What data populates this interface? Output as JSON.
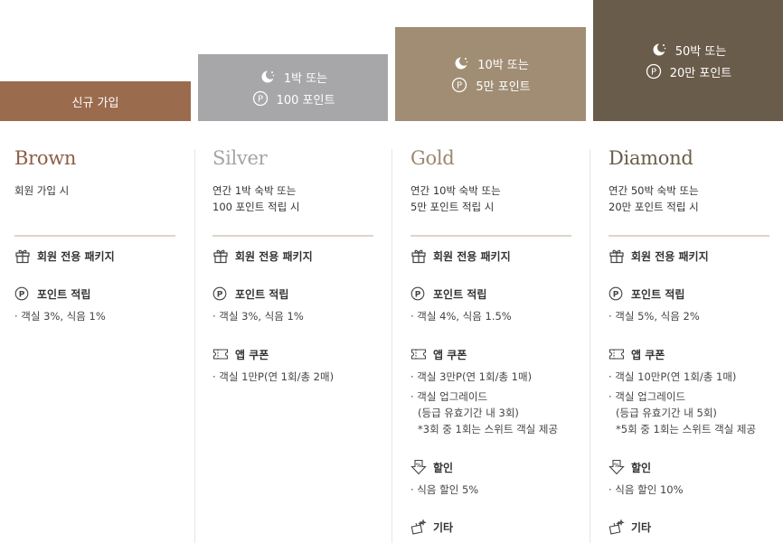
{
  "colors": {
    "brown": "#9b6b4e",
    "silver": "#a7a7a9",
    "gold": "#a08d74",
    "diamond": "#6a5c4a"
  },
  "bars": {
    "brown": {
      "label": "신규 가입"
    },
    "silver": {
      "nights": "1박 또는",
      "points": "100 포인트"
    },
    "gold": {
      "nights": "10박 또는",
      "points": "5만 포인트"
    },
    "diamond": {
      "nights": "50박 또는",
      "points": "20만 포인트"
    }
  },
  "tiers": [
    {
      "name": "Brown",
      "req1": "회원 가입 시",
      "req2": "",
      "package": "회원 전용 패키지",
      "points_title": "포인트 적립",
      "points_item": "· 객실 3%, 식음 1%"
    },
    {
      "name": "Silver",
      "req1": "연간 1박 숙박 또는",
      "req2": "100 포인트 적립 시",
      "package": "회원 전용 패키지",
      "points_title": "포인트 적립",
      "points_item": "· 객실 3%, 식음 1%",
      "coupon_title": "앱 쿠폰",
      "coupon_items": [
        "· 객실 1만P(연 1회/총 2매)"
      ]
    },
    {
      "name": "Gold",
      "req1": "연간 10박 숙박 또는",
      "req2": "5만 포인트 적립 시",
      "package": "회원 전용 패키지",
      "points_title": "포인트 적립",
      "points_item": "· 객실 4%, 식음 1.5%",
      "coupon_title": "앱 쿠폰",
      "coupon_items": [
        "· 객실 3만P(연 1회/총 1매)",
        "· 객실 업그레이드",
        "(등급 유효기간 내 3회)",
        "*3회 중 1회는 스위트 객실 제공"
      ],
      "discount_title": "할인",
      "discount_item": "· 식음 할인 5%",
      "etc_title": "기타"
    },
    {
      "name": "Diamond",
      "req1": "연간 50박 숙박 또는",
      "req2": "20만 포인트 적립 시",
      "package": "회원 전용 패키지",
      "points_title": "포인트 적립",
      "points_item": "· 객실 5%, 식음 2%",
      "coupon_title": "앱 쿠폰",
      "coupon_items": [
        "· 객실 10만P(연 1회/총 1매)",
        "· 객실 업그레이드",
        "(등급 유효기간 내 5회)",
        "*5회 중 1회는 스위트 객실 제공"
      ],
      "discount_title": "할인",
      "discount_item": "· 식음 할인 10%",
      "etc_title": "기타"
    }
  ]
}
